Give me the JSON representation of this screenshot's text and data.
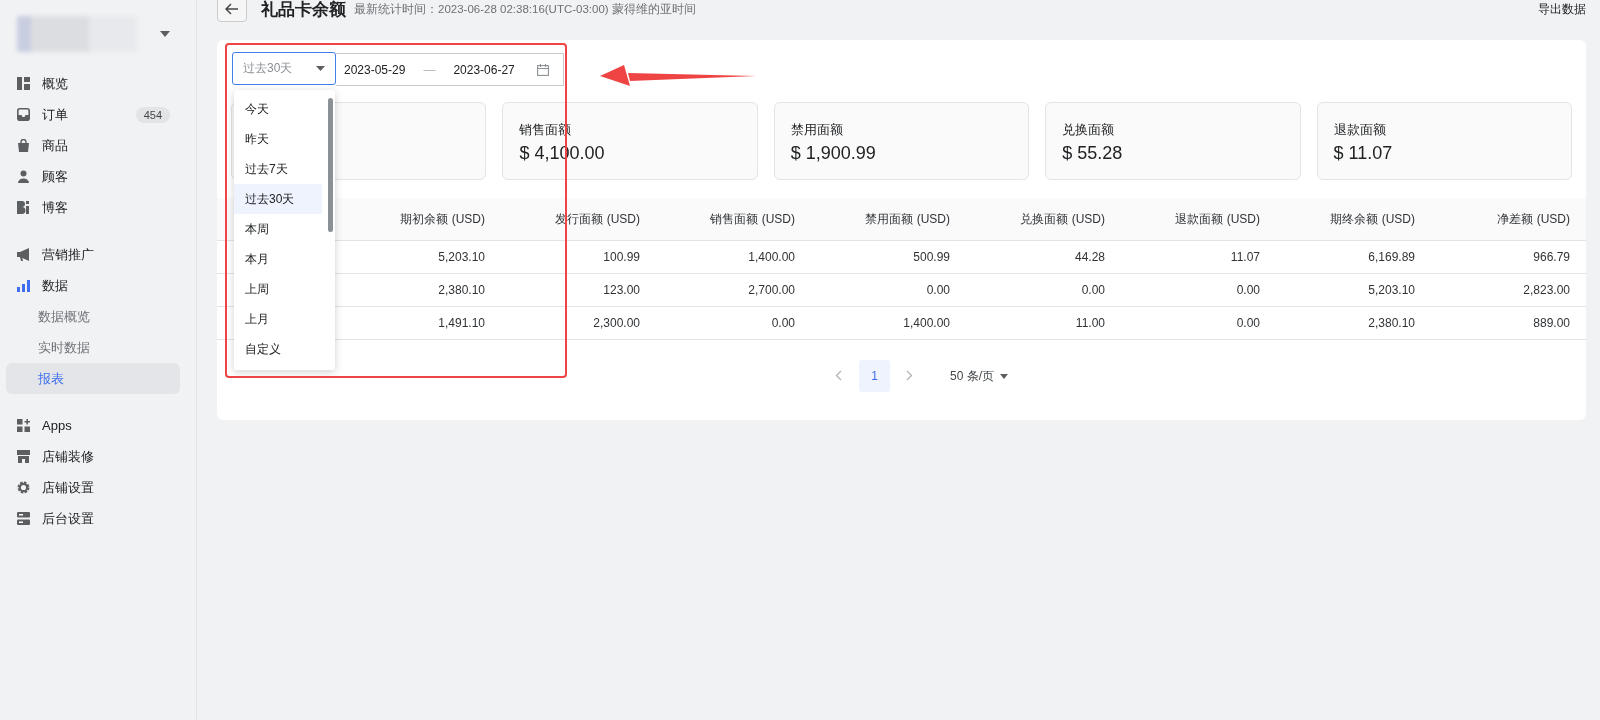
{
  "sidebar": {
    "items": [
      {
        "label": "概览",
        "selected": false
      },
      {
        "label": "订单",
        "badge": "454",
        "selected": false
      },
      {
        "label": "商品",
        "selected": false
      },
      {
        "label": "顾客",
        "selected": false
      },
      {
        "label": "博客",
        "selected": false
      },
      {
        "label": "营销推广",
        "selected": false,
        "group_start": true
      },
      {
        "label": "数据",
        "selected": false,
        "expanded": true,
        "children": [
          {
            "label": "数据概览",
            "selected": false
          },
          {
            "label": "实时数据",
            "selected": false
          },
          {
            "label": "报表",
            "selected": true
          }
        ]
      },
      {
        "label": "Apps",
        "selected": false,
        "group_start": true
      },
      {
        "label": "店铺装修",
        "selected": false
      },
      {
        "label": "店铺设置",
        "selected": false
      },
      {
        "label": "后台设置",
        "selected": false
      }
    ]
  },
  "header": {
    "title": "礼品卡余额",
    "subtitle": "最新统计时间：2023-06-28 02:38:16(UTC-03:00) 蒙得维的亚时间",
    "export": "导出数据"
  },
  "filter": {
    "preset": "过去30天",
    "start": "2023-05-29",
    "separator": "—",
    "end": "2023-06-27",
    "open": true,
    "options": [
      {
        "label": "今天",
        "selected": false
      },
      {
        "label": "昨天",
        "selected": false
      },
      {
        "label": "过去7天",
        "selected": false
      },
      {
        "label": "过去30天",
        "selected": true
      },
      {
        "label": "本周",
        "selected": false
      },
      {
        "label": "本月",
        "selected": false
      },
      {
        "label": "上周",
        "selected": false
      },
      {
        "label": "上月",
        "selected": false
      },
      {
        "label": "自定义",
        "selected": false
      }
    ]
  },
  "stats": [
    {
      "label": "销售面额",
      "value": "$ 4,100.00"
    },
    {
      "label": "禁用面额",
      "value": "$ 1,900.99"
    },
    {
      "label": "兑换面额",
      "value": "$ 55.28"
    },
    {
      "label": "退款面额",
      "value": "$ 11.07"
    }
  ],
  "table": {
    "columns": [
      "期初余额 (USD)",
      "发行面额 (USD)",
      "销售面额 (USD)",
      "禁用面额 (USD)",
      "兑换面额 (USD)",
      "退款面额 (USD)",
      "期终余额 (USD)",
      "净差额 (USD)"
    ],
    "rows": [
      [
        "5,203.10",
        "100.99",
        "1,400.00",
        "500.99",
        "44.28",
        "11.07",
        "6,169.89",
        "966.79"
      ],
      [
        "2,380.10",
        "123.00",
        "2,700.00",
        "0.00",
        "0.00",
        "0.00",
        "5,203.10",
        "2,823.00"
      ],
      [
        "1,491.10",
        "2,300.00",
        "0.00",
        "1,400.00",
        "11.00",
        "0.00",
        "2,380.10",
        "889.00"
      ]
    ]
  },
  "pagination": {
    "pages": [
      {
        "label": "1",
        "selected": true
      }
    ],
    "page_size": "50 条/页"
  }
}
